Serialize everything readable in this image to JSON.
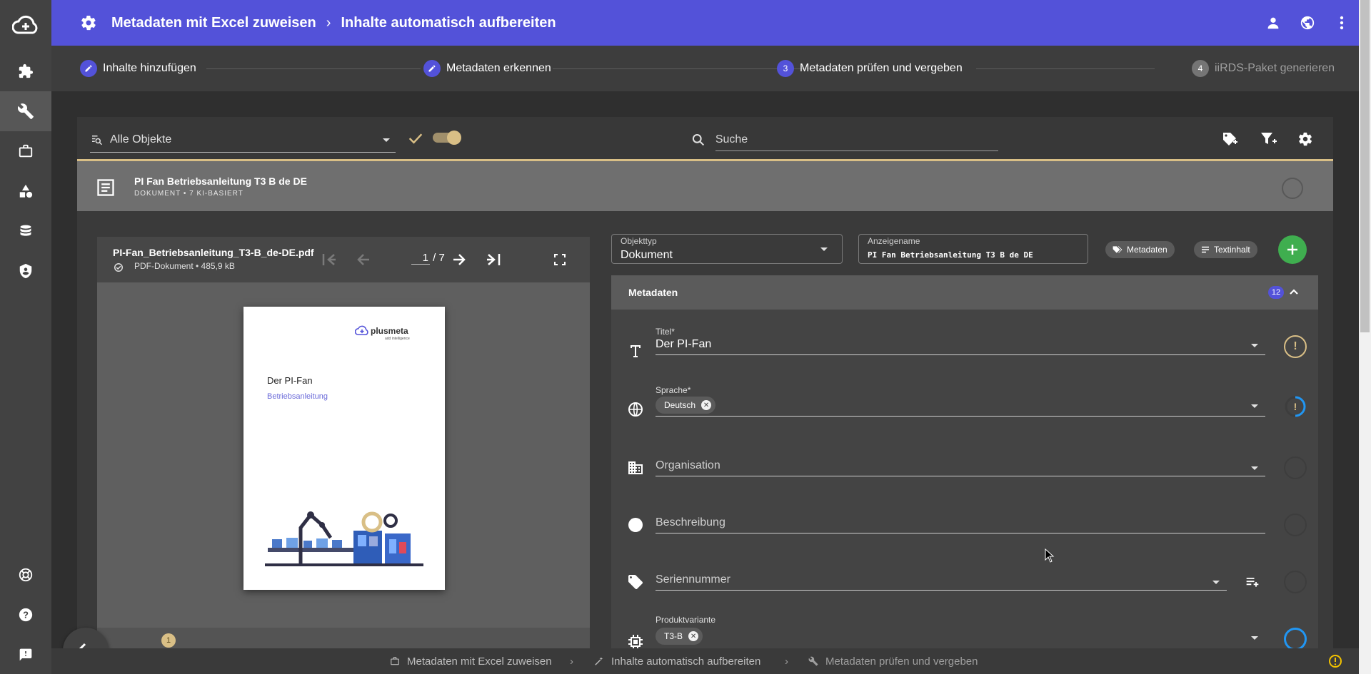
{
  "header": {
    "crumb1": "Metadaten mit Excel zuweisen",
    "crumb2": "Inhalte automatisch aufbereiten"
  },
  "stepper": [
    {
      "label": "Inhalte hinzufügen",
      "marker": "edit"
    },
    {
      "label": "Metadaten erkennen",
      "marker": "edit"
    },
    {
      "label": "Metadaten prüfen und vergeben",
      "marker": "3"
    },
    {
      "label": "iiRDS-Paket generieren",
      "marker": "4"
    }
  ],
  "toolbar": {
    "filter_value": "Alle Objekte",
    "search_placeholder": "Suche"
  },
  "document": {
    "title": "PI Fan Betriebsanleitung T3 B de DE",
    "subtitle": "DOKUMENT • 7 KI-BASIERT"
  },
  "viewer": {
    "file_name": "PI-Fan_Betriebsanleitung_T3-B_de-DE.pdf",
    "file_meta": "PDF-Dokument • 485,9 kB",
    "page_current": "1",
    "page_total": "/ 7",
    "page_brand": "plusmeta",
    "page_brand_tag": "add intelligence",
    "page_heading": "Der PI-Fan",
    "page_subheading": "Betriebsanleitung",
    "footer_marker": "1"
  },
  "form": {
    "objekttyp_label": "Objekttyp",
    "objekttyp_value": "Dokument",
    "anzeigename_label": "Anzeigename",
    "anzeigename_value": "PI Fan Betriebsanleitung T3 B de DE",
    "metadaten_button": "Metadaten",
    "textinhalt_button": "Textinhalt"
  },
  "metadata": {
    "title": "Metadaten",
    "count": "12",
    "fields": {
      "titel_label": "Titel*",
      "titel_value": "Der PI-Fan",
      "sprache_label": "Sprache*",
      "sprache_chip": "Deutsch",
      "organisation_placeholder": "Organisation",
      "beschreibung_placeholder": "Beschreibung",
      "seriennummer_placeholder": "Seriennummer",
      "produktvariante_label": "Produktvariante",
      "produktvariante_chip": "T3-B"
    }
  },
  "bottombar": {
    "item1": "Metadaten mit Excel zuweisen",
    "item2": "Inhalte automatisch aufbereiten",
    "item3": "Metadaten prüfen und vergeben"
  },
  "colors": {
    "accent": "#5352d9",
    "warning": "#d9bf86",
    "success": "#3fae4f",
    "progress": "#2196f3"
  }
}
